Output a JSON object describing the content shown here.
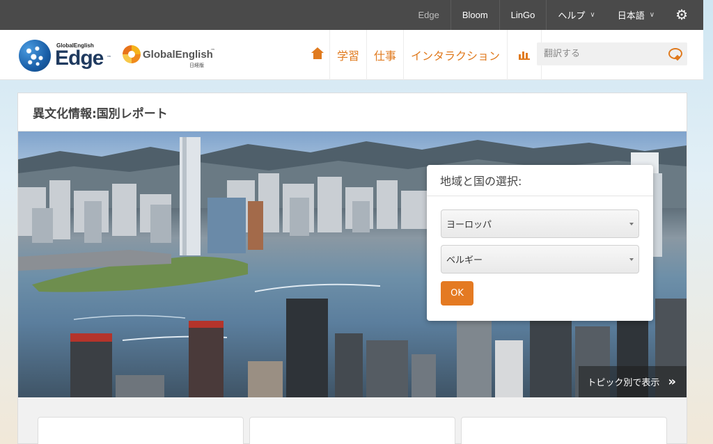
{
  "topbar": {
    "items": [
      {
        "label": "Edge"
      },
      {
        "label": "Bloom"
      },
      {
        "label": "LinGo"
      },
      {
        "label": "ヘルプ"
      },
      {
        "label": "日本語"
      }
    ]
  },
  "logos": {
    "edge_small": "GlobalEnglish",
    "edge_big": "Edge",
    "ge_name": "GlobalEnglish",
    "ge_sub": "日経版",
    "tm": "™"
  },
  "nav": {
    "items": [
      {
        "label": "学習"
      },
      {
        "label": "仕事"
      },
      {
        "label": "インタラクション"
      }
    ]
  },
  "search": {
    "placeholder": "翻訳する"
  },
  "page": {
    "title": "異文化情報:国別レポート"
  },
  "selector": {
    "title": "地域と国の選択:",
    "region": "ヨーロッパ",
    "country": "ベルギー",
    "ok_label": "OK"
  },
  "topic_link": {
    "label": "トピック別で表示",
    "arrow": "»"
  },
  "colors": {
    "accent": "#e47a22",
    "topbar": "#4a4a4a"
  }
}
